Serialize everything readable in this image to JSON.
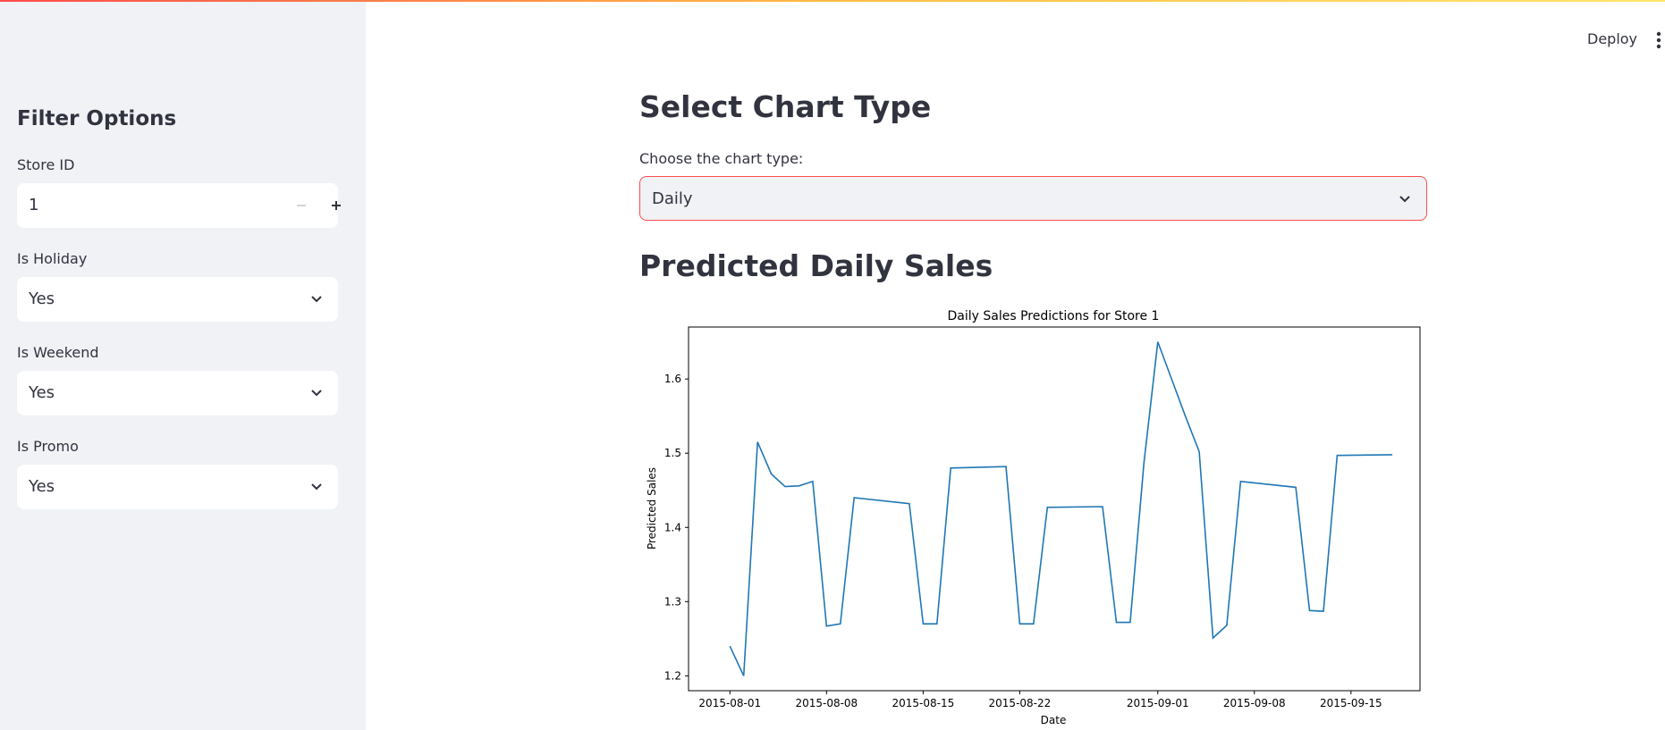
{
  "header": {
    "deploy_label": "Deploy",
    "menu_icon": "kebab-menu-icon"
  },
  "sidebar": {
    "title": "Filter Options",
    "store_id": {
      "label": "Store ID",
      "value": "1",
      "minus_icon": "minus-icon",
      "plus_icon": "plus-icon"
    },
    "is_holiday": {
      "label": "Is Holiday",
      "value": "Yes"
    },
    "is_weekend": {
      "label": "Is Weekend",
      "value": "Yes"
    },
    "is_promo": {
      "label": "Is Promo",
      "value": "Yes"
    }
  },
  "main": {
    "select_heading": "Select Chart Type",
    "chart_type_label": "Choose the chart type:",
    "chart_type_value": "Daily",
    "chart_heading": "Predicted Daily Sales"
  },
  "colors": {
    "accent": "#ff4b4b",
    "sidebar_bg": "#f0f2f6",
    "line": "#1f77b4"
  },
  "chart_data": {
    "type": "line",
    "title": "Daily Sales Predictions for Store 1",
    "xlabel": "Date",
    "ylabel": "Predicted Sales",
    "grid": false,
    "x_ticks": [
      "2015-08-01",
      "2015-08-08",
      "2015-08-15",
      "2015-08-22",
      "2015-09-01",
      "2015-09-08",
      "2015-09-15"
    ],
    "y_ticks": [
      "1.2",
      "1.3",
      "1.4",
      "1.5",
      "1.6"
    ],
    "xlim": [
      "2015-07-29",
      "2015-09-20"
    ],
    "ylim": [
      1.18,
      1.67
    ],
    "series": [
      {
        "x": [
          "2015-08-01",
          "2015-08-02",
          "2015-08-03",
          "2015-08-04",
          "2015-08-05",
          "2015-08-06",
          "2015-08-07",
          "2015-08-08",
          "2015-08-09",
          "2015-08-10",
          "2015-08-14",
          "2015-08-15",
          "2015-08-16",
          "2015-08-17",
          "2015-08-21",
          "2015-08-22",
          "2015-08-23",
          "2015-08-24",
          "2015-08-28",
          "2015-08-29",
          "2015-08-30",
          "2015-08-31",
          "2015-09-01",
          "2015-09-02",
          "2015-09-03",
          "2015-09-04",
          "2015-09-05",
          "2015-09-06",
          "2015-09-07",
          "2015-09-11",
          "2015-09-12",
          "2015-09-13",
          "2015-09-14",
          "2015-09-18"
        ],
        "values": [
          1.24,
          1.2,
          1.515,
          1.472,
          1.455,
          1.456,
          1.462,
          1.267,
          1.27,
          1.44,
          1.432,
          1.27,
          1.27,
          1.48,
          1.482,
          1.27,
          1.27,
          1.427,
          1.428,
          1.272,
          1.272,
          1.487,
          1.65,
          1.6,
          1.55,
          1.502,
          1.251,
          1.268,
          1.462,
          1.454,
          1.288,
          1.287,
          1.497,
          1.498
        ]
      }
    ]
  }
}
